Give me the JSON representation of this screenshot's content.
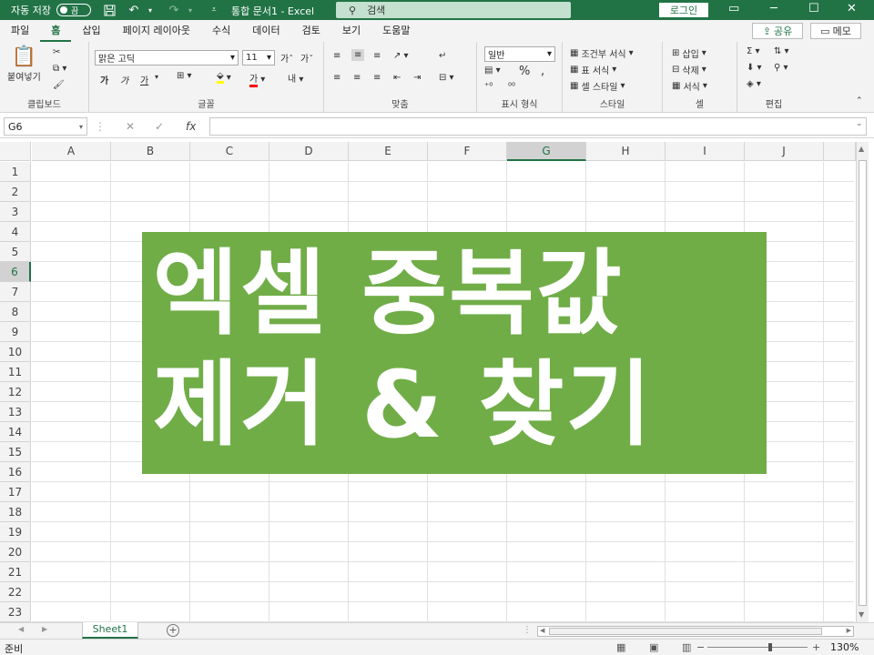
{
  "titlebar": {
    "autosave_label": "자동 저장",
    "autosave_state": "끔",
    "document_title": "통합 문서1  -  Excel",
    "search_placeholder": "검색",
    "login_label": "로그인"
  },
  "menu": {
    "tabs": [
      "파일",
      "홈",
      "삽입",
      "페이지 레이아웃",
      "수식",
      "데이터",
      "검토",
      "보기",
      "도움말"
    ],
    "active_tab": "홈",
    "share_label": "공유",
    "memo_label": "메모"
  },
  "ribbon": {
    "clipboard": {
      "label": "클립보드",
      "paste_label": "붙여넣기"
    },
    "font": {
      "label": "글꼴",
      "font_name": "맑은 고딕",
      "font_size": "11",
      "bold": "가",
      "italic": "가",
      "underline": "가"
    },
    "alignment": {
      "label": "맞춤"
    },
    "number": {
      "label": "표시 형식",
      "format": "일반"
    },
    "styles": {
      "label": "스타일",
      "conditional": "조건부 서식",
      "table": "표 서식",
      "cell_style": "셀 스타일"
    },
    "cells": {
      "label": "셀",
      "insert": "삽입",
      "delete": "삭제",
      "format": "서식"
    },
    "editing": {
      "label": "편집"
    }
  },
  "formula_bar": {
    "name_box": "G6",
    "fx": "fx",
    "cancel": "✕",
    "confirm": "✓"
  },
  "grid": {
    "columns": [
      "A",
      "B",
      "C",
      "D",
      "E",
      "F",
      "G",
      "H",
      "I",
      "J"
    ],
    "rows": [
      "1",
      "2",
      "3",
      "4",
      "5",
      "6",
      "7",
      "8",
      "9",
      "10",
      "11",
      "12",
      "13",
      "14",
      "15",
      "16",
      "17",
      "18",
      "19",
      "20",
      "21",
      "22",
      "23"
    ],
    "selected_column": "G",
    "selected_row": "6"
  },
  "banner": {
    "line1": "엑셀  중복값",
    "line2": "제거  &  찾기",
    "background": "#70ad47"
  },
  "sheets": {
    "tabs": [
      "Sheet1"
    ]
  },
  "status": {
    "ready": "준비",
    "zoom": "130%"
  },
  "colors": {
    "excel_green": "#217346",
    "banner_green": "#70ad47"
  }
}
